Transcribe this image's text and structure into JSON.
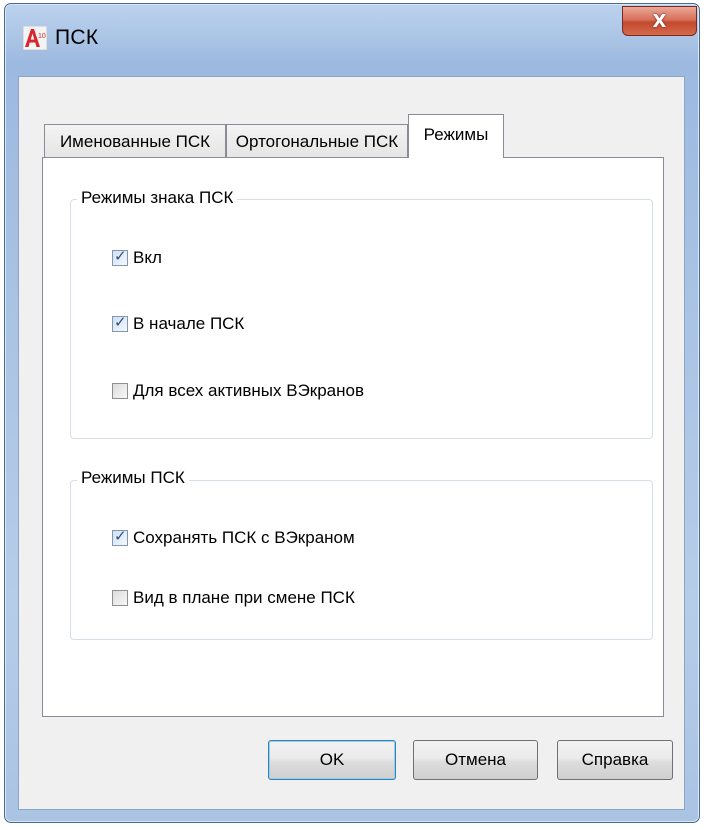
{
  "window": {
    "title": "ПСК",
    "close_label": "X"
  },
  "tabs": [
    {
      "label": "Именованные ПСК",
      "active": false
    },
    {
      "label": "Ортогональные ПСК",
      "active": false
    },
    {
      "label": "Режимы",
      "active": true
    }
  ],
  "groups": {
    "icon_modes": {
      "label": "Режимы знака ПСК",
      "options": [
        {
          "label": "Вкл",
          "checked": true
        },
        {
          "label": "В начале ПСК",
          "checked": true
        },
        {
          "label": "Для всех активных ВЭкранов",
          "checked": false
        }
      ]
    },
    "ucs_modes": {
      "label": "Режимы ПСК",
      "options": [
        {
          "label": "Сохранять ПСК с ВЭкраном",
          "checked": true
        },
        {
          "label": "Вид в плане при смене ПСК",
          "checked": false
        }
      ]
    }
  },
  "buttons": {
    "ok": "OK",
    "cancel": "Отмена",
    "help": "Справка"
  },
  "icons": {
    "app": "autocad-app-icon",
    "close": "close-icon",
    "check": "checkmark-icon"
  },
  "colors": {
    "frame": "#a8c2e4",
    "close": "#c24a2f",
    "check": "#2d4e8a"
  }
}
